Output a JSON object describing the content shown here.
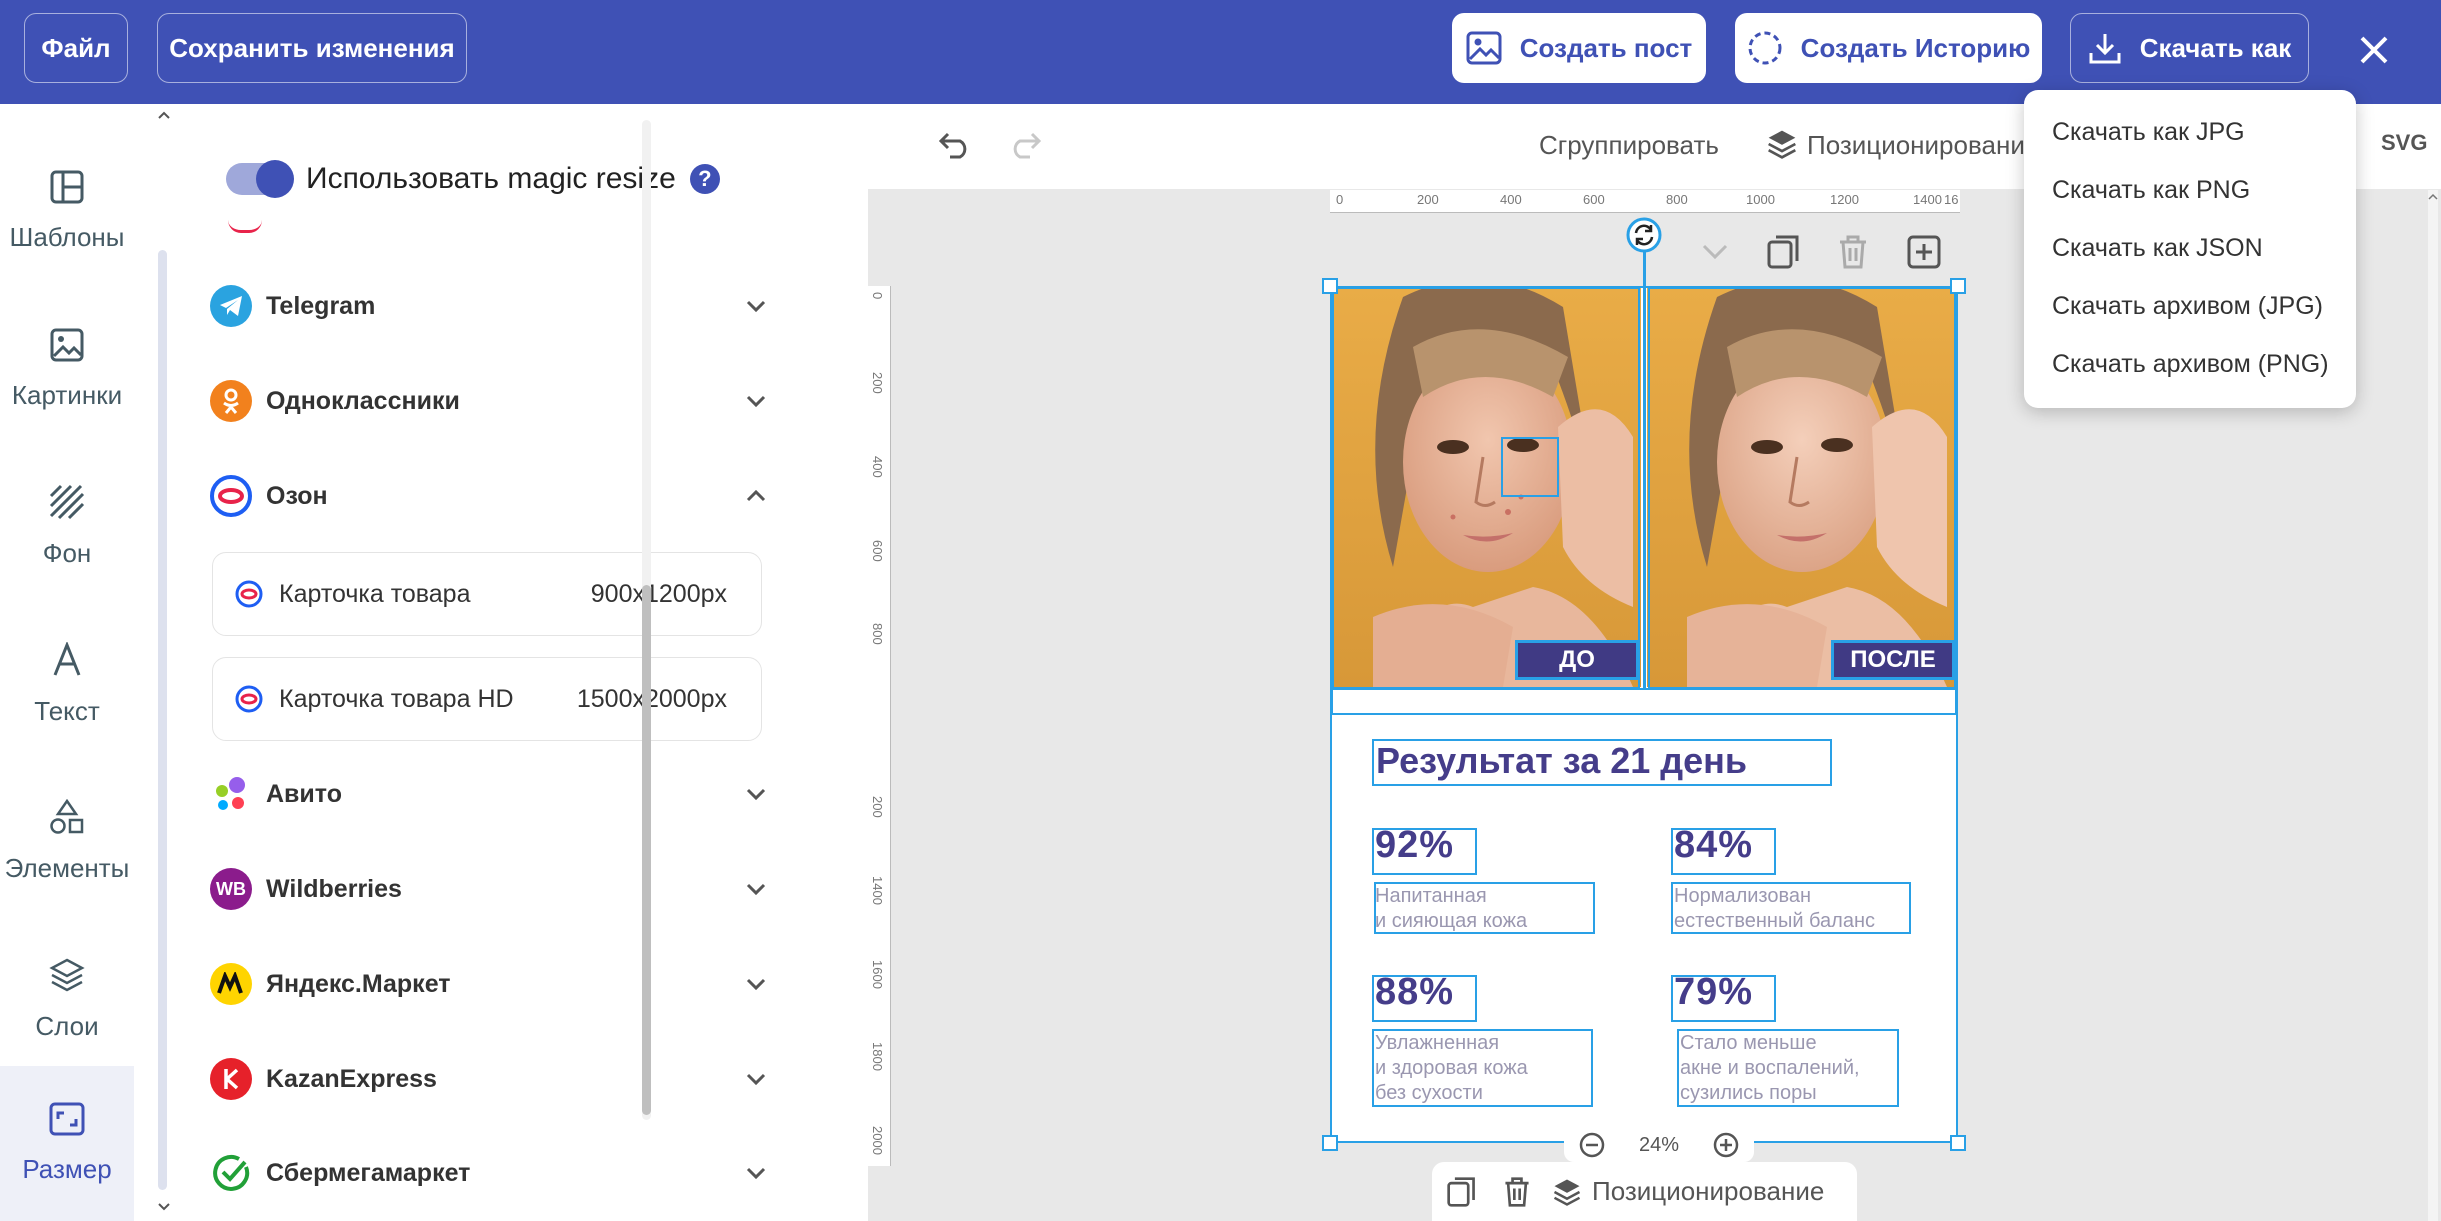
{
  "header": {
    "file_label": "Файл",
    "save_label": "Сохранить изменения",
    "create_post_label": "Создать пост",
    "create_story_label": "Создать Историю",
    "download_label": "Скачать как"
  },
  "download_menu": {
    "items": [
      "Скачать как JPG",
      "Скачать как PNG",
      "Скачать как JSON",
      "Скачать архивом (JPG)",
      "Скачать архивом (PNG)"
    ]
  },
  "rail": {
    "items": [
      {
        "label": "Шаблоны",
        "icon": "templates-icon"
      },
      {
        "label": "Картинки",
        "icon": "image-icon"
      },
      {
        "label": "Фон",
        "icon": "background-icon"
      },
      {
        "label": "Текст",
        "icon": "text-icon"
      },
      {
        "label": "Элементы",
        "icon": "shapes-icon"
      },
      {
        "label": "Слои",
        "icon": "layers-icon"
      },
      {
        "label": "Размер",
        "icon": "resize-icon"
      }
    ]
  },
  "panel": {
    "magic_resize_label": "Использовать magic resize",
    "help": "?",
    "networks": [
      {
        "label": "Telegram",
        "color": "#2aa3e0"
      },
      {
        "label": "Одноклассники",
        "color": "#f2811d"
      },
      {
        "label": "Озон",
        "color": "#e8234a"
      },
      {
        "label": "Авито",
        "color": "#97cf26"
      },
      {
        "label": "Wildberries",
        "color": "#8b1c8c",
        "logo_text": "WB"
      },
      {
        "label": "Яндекс.Маркет",
        "color": "#ffd400"
      },
      {
        "label": "KazanExpress",
        "color": "#e6212a"
      },
      {
        "label": "Сбермегамаркет",
        "color": "#21a038"
      }
    ],
    "ozon_formats": [
      {
        "name": "Карточка товара",
        "size": "900x1200px"
      },
      {
        "name": "Карточка товара HD",
        "size": "1500x2000px"
      }
    ]
  },
  "toolbar": {
    "group_label": "Сгруппировать",
    "position_label": "Позиционирование",
    "svg_label": "SVG"
  },
  "rulers": {
    "horizontal": [
      "0",
      "200",
      "400",
      "600",
      "800",
      "1000",
      "1200",
      "1400",
      "16"
    ],
    "vertical": [
      "0",
      "200",
      "400",
      "600",
      "800",
      "200",
      "1400",
      "1600",
      "1800",
      "2000"
    ]
  },
  "design": {
    "before_label": "ДО",
    "after_label": "ПОСЛЕ",
    "title": "Результат за 21 день",
    "stats": [
      {
        "value": "92%",
        "desc": "Напитанная\nи сияющая кожа"
      },
      {
        "value": "84%",
        "desc": "Нормализован\nестественный баланс"
      },
      {
        "value": "88%",
        "desc": "Увлажненная\nи здоровая кожа\nбез сухости"
      },
      {
        "value": "79%",
        "desc": "Стало меньше\nакне и воспалений,\nсузились поры"
      }
    ]
  },
  "zoom": {
    "value": "24%"
  },
  "bottom_bar": {
    "position_label": "Позиционирование"
  }
}
